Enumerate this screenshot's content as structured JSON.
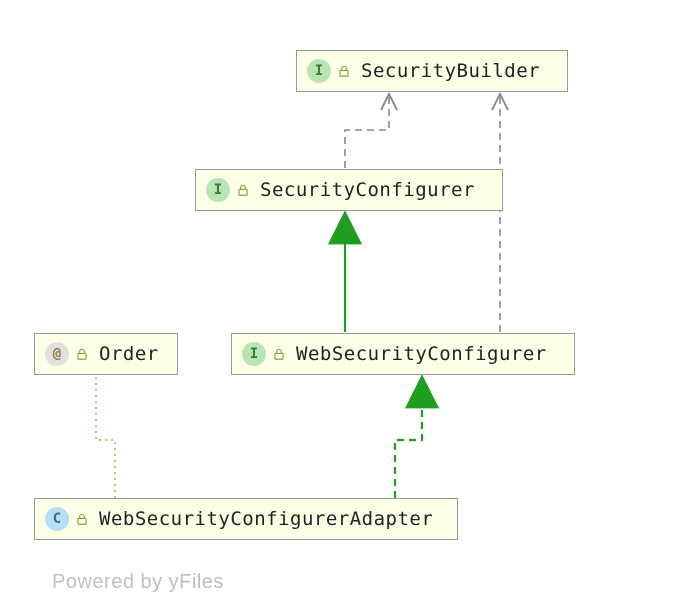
{
  "nodes": {
    "securityBuilder": {
      "label": "SecurityBuilder",
      "kind": "interface"
    },
    "securityConfigurer": {
      "label": "SecurityConfigurer",
      "kind": "interface"
    },
    "webSecurityConfigurer": {
      "label": "WebSecurityConfigurer",
      "kind": "interface"
    },
    "order": {
      "label": "Order",
      "kind": "annotation"
    },
    "webSecurityConfigurerAdapter": {
      "label": "WebSecurityConfigurerAdapter",
      "kind": "class"
    }
  },
  "badges": {
    "interface": "I",
    "annotation": "@",
    "class": "C"
  },
  "footer": "Powered by yFiles"
}
